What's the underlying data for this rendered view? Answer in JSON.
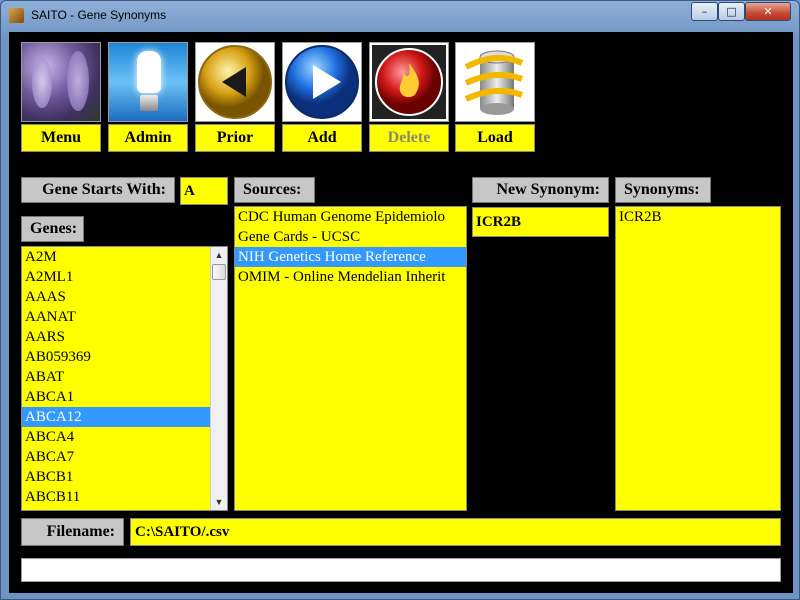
{
  "window": {
    "title": "SAITO - Gene Synonyms",
    "controls": {
      "minimize": "–",
      "maximize": "□",
      "close": "✕"
    }
  },
  "toolbar": [
    {
      "label": "Menu",
      "icon": "wisteria-flowers-icon",
      "enabled": true
    },
    {
      "label": "Admin",
      "icon": "light-bulb-icon",
      "enabled": true
    },
    {
      "label": "Prior",
      "icon": "back-arrow-icon",
      "enabled": true
    },
    {
      "label": "Add",
      "icon": "play-arrow-icon",
      "enabled": true
    },
    {
      "label": "Delete",
      "icon": "flame-icon",
      "enabled": false
    },
    {
      "label": "Load",
      "icon": "database-icon",
      "enabled": true
    }
  ],
  "gene_filter": {
    "label": "Gene Starts With:",
    "value": "A"
  },
  "genes": {
    "label": "Genes:",
    "items": [
      "A2M",
      "A2ML1",
      "AAAS",
      "AANAT",
      "AARS",
      "AB059369",
      "ABAT",
      "ABCA1",
      "ABCA12",
      "ABCA4",
      "ABCA7",
      "ABCB1",
      "ABCB11"
    ],
    "selected": "ABCA12"
  },
  "sources": {
    "label": "Sources:",
    "items": [
      "CDC Human Genome Epidemiolo",
      "Gene Cards - UCSC",
      "NIH Genetics Home Reference",
      "OMIM - Online Mendelian Inherit"
    ],
    "selected": "NIH Genetics Home Reference"
  },
  "new_synonym": {
    "label": "New Synonym:",
    "value": "ICR2B"
  },
  "synonyms": {
    "label": "Synonyms:",
    "items": [
      "ICR2B"
    ]
  },
  "filename": {
    "label": "Filename:",
    "value": "C:\\SAITO/.csv"
  },
  "status": {
    "text": ""
  },
  "colors": {
    "field_bg": "#ffff00",
    "selection": "#3399ff",
    "background": "#000000",
    "label_bg": "#c6c6c6"
  }
}
